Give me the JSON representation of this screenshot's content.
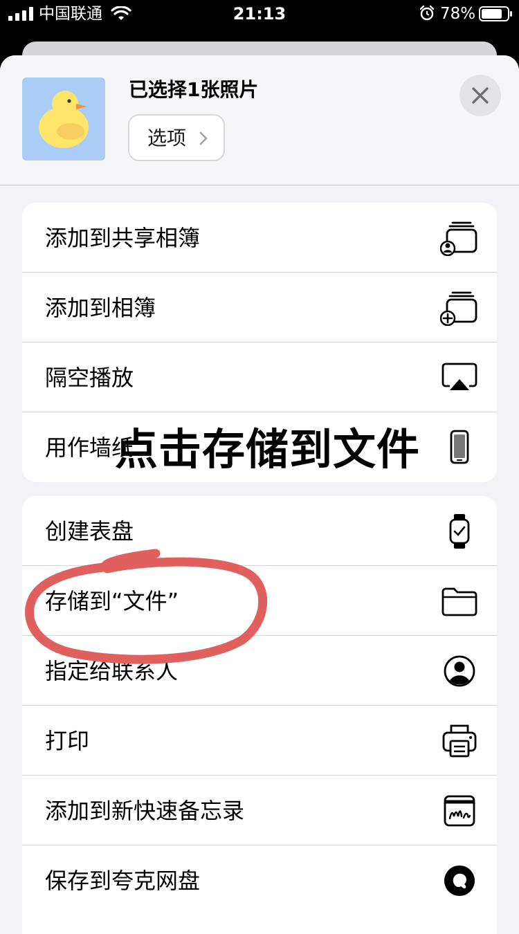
{
  "status_bar": {
    "carrier": "中国联通",
    "time": "21:13",
    "battery_percent": "78%"
  },
  "share_sheet": {
    "title": "已选择1张照片",
    "options_label": "选项",
    "group1": [
      {
        "label": "添加到共享相簿",
        "icon": "shared-album-icon"
      },
      {
        "label": "添加到相簿",
        "icon": "add-album-icon"
      },
      {
        "label": "隔空播放",
        "icon": "airplay-icon"
      },
      {
        "label": "用作墙纸",
        "icon": "phone-icon"
      }
    ],
    "group2": [
      {
        "label": "创建表盘",
        "icon": "watch-icon"
      },
      {
        "label": "存储到“文件”",
        "icon": "folder-icon"
      },
      {
        "label": "指定给联系人",
        "icon": "contact-icon"
      },
      {
        "label": "打印",
        "icon": "printer-icon"
      },
      {
        "label": "添加到新快速备忘录",
        "icon": "quick-note-icon"
      },
      {
        "label": "保存到夸克网盘",
        "icon": "quark-icon"
      }
    ]
  },
  "annotation": {
    "text": "点击存储到文件",
    "circle_color": "#e0605e"
  }
}
